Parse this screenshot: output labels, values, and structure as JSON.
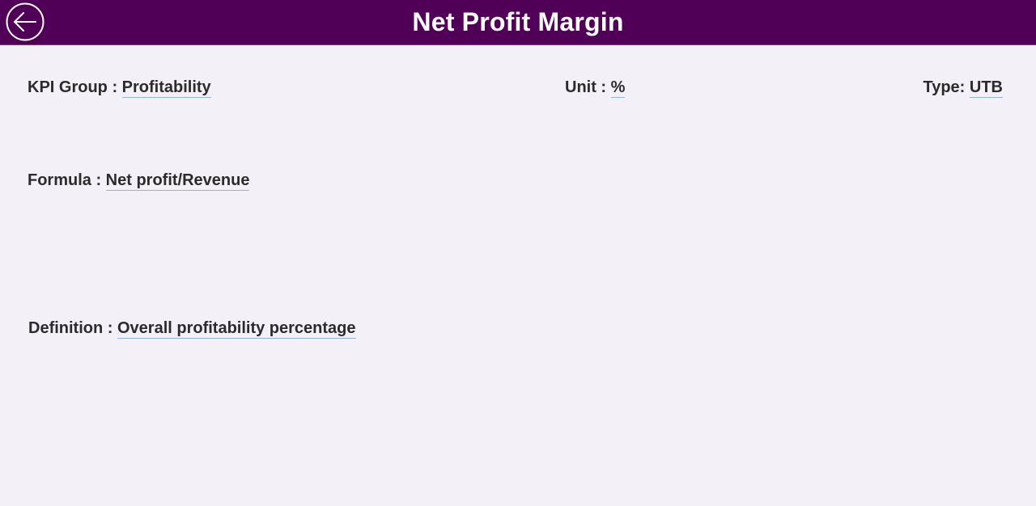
{
  "header": {
    "title": "Net Profit Margin",
    "back_icon": "arrow-left-circle-icon",
    "background_color": "#500057"
  },
  "fields": {
    "kpi_group": {
      "label": "KPI Group : ",
      "value": "Profitability"
    },
    "unit": {
      "label": "Unit : ",
      "value": "%"
    },
    "type": {
      "label": "Type: ",
      "value": "UTB"
    },
    "formula": {
      "label": "Formula : ",
      "value": "Net profit/Revenue"
    },
    "definition": {
      "label": "Definition : ",
      "value": "Overall profitability percentage"
    }
  },
  "colors": {
    "page_background": "#f4f0f7",
    "title_text": "#ffffff",
    "underline": "#8fb6d6"
  }
}
